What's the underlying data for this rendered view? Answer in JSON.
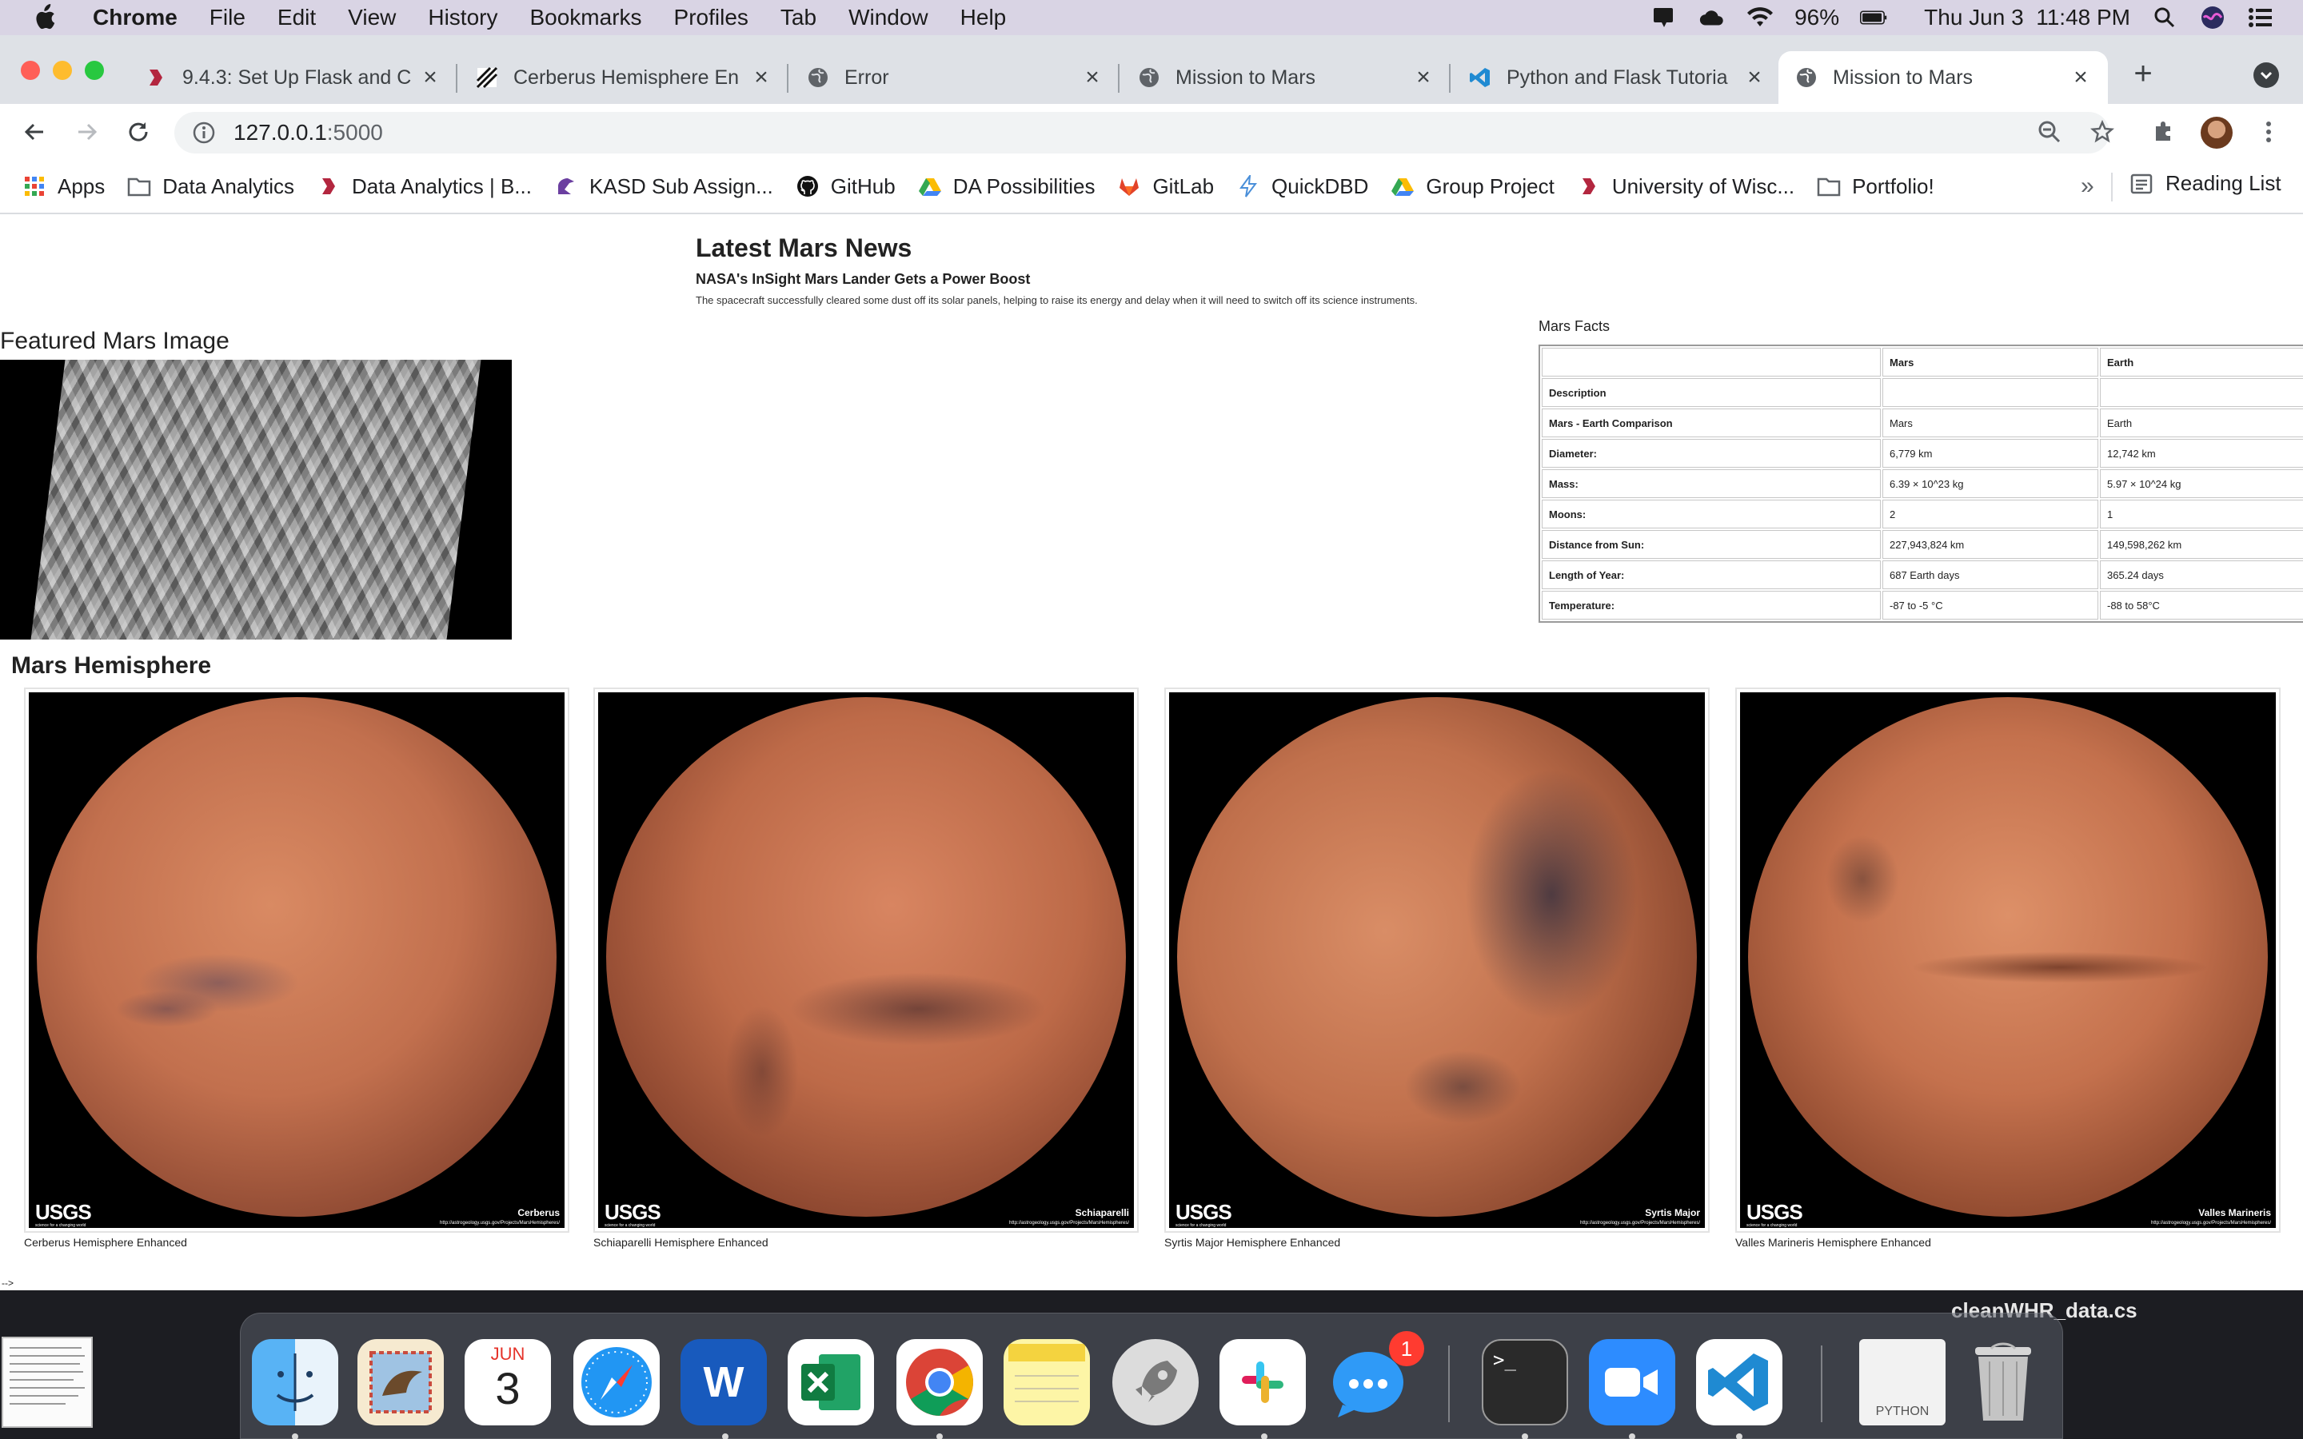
{
  "menubar": {
    "app_name": "Chrome",
    "items": [
      "File",
      "Edit",
      "View",
      "History",
      "Bookmarks",
      "Profiles",
      "Tab",
      "Window",
      "Help"
    ],
    "battery": "96%",
    "clock": "Thu Jun 3  11:48 PM"
  },
  "tabs": [
    {
      "title": "9.4.3: Set Up Flask and C",
      "icon": "bcs-icon"
    },
    {
      "title": "Cerberus Hemisphere En",
      "icon": "usgs-icon"
    },
    {
      "title": "Error",
      "icon": "globe-icon"
    },
    {
      "title": "Mission to Mars",
      "icon": "globe-icon"
    },
    {
      "title": "Python and Flask Tutoria",
      "icon": "vscode-icon"
    },
    {
      "title": "Mission to Mars",
      "icon": "globe-icon",
      "active": true
    }
  ],
  "toolbar": {
    "url_host": "127.0.0.1",
    "url_port": ":5000"
  },
  "bookmarks": {
    "items": [
      "Apps",
      "Data Analytics",
      "Data Analytics | B...",
      "KASD Sub Assign...",
      "GitHub",
      "DA Possibilities",
      "GitLab",
      "QuickDBD",
      "Group Project",
      "University of Wisc...",
      "Portfolio!"
    ],
    "overflow": "»",
    "reading_list": "Reading List"
  },
  "news": {
    "heading": "Latest Mars News",
    "title": "NASA's InSight Mars Lander Gets a Power Boost",
    "paragraph": "The spacecraft successfully cleared some dust off its solar panels, helping to raise its energy and delay when it will need to switch off its science instruments."
  },
  "featured": {
    "heading": "Featured Mars Image"
  },
  "facts": {
    "heading": "Mars Facts",
    "columns": [
      "",
      "Mars",
      "Earth"
    ],
    "rows": [
      [
        "Description",
        "",
        ""
      ],
      [
        "Mars - Earth Comparison",
        "Mars",
        "Earth"
      ],
      [
        "Diameter:",
        "6,779 km",
        "12,742 km"
      ],
      [
        "Mass:",
        "6.39 × 10^23 kg",
        "5.97 × 10^24 kg"
      ],
      [
        "Moons:",
        "2",
        "1"
      ],
      [
        "Distance from Sun:",
        "227,943,824 km",
        "149,598,262 km"
      ],
      [
        "Length of Year:",
        "687 Earth days",
        "365.24 days"
      ],
      [
        "Temperature:",
        "-87 to -5 °C",
        "-88 to 58°C"
      ]
    ]
  },
  "hemispheres": {
    "heading": "Mars Hemisphere",
    "items": [
      {
        "caption": "Cerberus Hemisphere Enhanced",
        "label": "Cerberus"
      },
      {
        "caption": "Schiaparelli Hemisphere Enhanced",
        "label": "Schiaparelli"
      },
      {
        "caption": "Syrtis Major Hemisphere Enhanced",
        "label": "Syrtis Major"
      },
      {
        "caption": "Valles Marineris Hemisphere Enhanced",
        "label": "Valles Marineris"
      }
    ],
    "logo_text": "USGS",
    "logo_sub": "science for a changing world",
    "url_text": "http://astrogeology.usgs.gov/Projects/MarsHemispheres/"
  },
  "page_footer": "-->",
  "desktop": {
    "file_name": "cleanWHR_data.cs"
  },
  "dock": {
    "calendar_month": "JUN",
    "calendar_day": "3",
    "messages_badge": "1",
    "python_label": "PYTHON"
  },
  "colors": {
    "menubar_bg": "#d9d4e4",
    "tabstrip_bg": "#dee1e6",
    "mars_base": "#c2704e"
  }
}
